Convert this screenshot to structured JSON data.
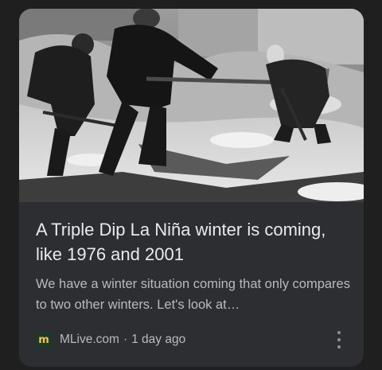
{
  "card": {
    "title": "A Triple Dip La Niña winter is coming, like 1976 and 2001",
    "snippet": "We have a winter situation coming that only compares to two other winters. Let's look at…",
    "source": "MLive.com",
    "separator": "·",
    "age": "1 day ago",
    "favicon_letter": "m"
  },
  "colors": {
    "card_bg": "#2d2e31",
    "page_bg": "#1f1f1f",
    "title_text": "#e9eaed",
    "secondary_text": "#b8babe"
  }
}
